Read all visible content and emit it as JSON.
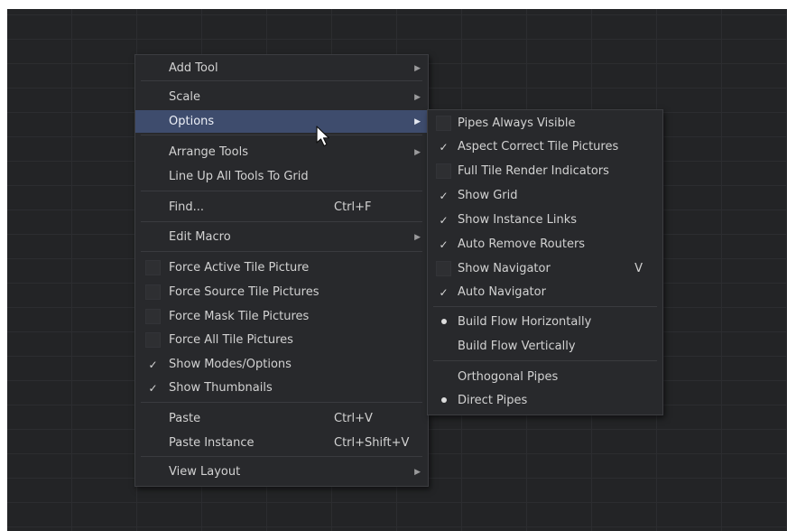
{
  "main_menu": {
    "add_tool": "Add Tool",
    "scale": "Scale",
    "options": "Options",
    "arrange_tools": "Arrange Tools",
    "line_up": "Line Up All Tools To Grid",
    "find": "Find...",
    "find_shortcut": "Ctrl+F",
    "edit_macro": "Edit Macro",
    "force_active": "Force Active Tile Picture",
    "force_source": "Force Source Tile Pictures",
    "force_mask": "Force Mask Tile Pictures",
    "force_all": "Force All Tile Pictures",
    "show_modes": "Show Modes/Options",
    "show_thumbnails": "Show Thumbnails",
    "paste": "Paste",
    "paste_shortcut": "Ctrl+V",
    "paste_instance": "Paste Instance",
    "paste_instance_shortcut": "Ctrl+Shift+V",
    "view_layout": "View Layout"
  },
  "options_menu": {
    "pipes_always_visible": "Pipes Always Visible",
    "aspect_correct": "Aspect Correct Tile Pictures",
    "full_tile_render": "Full Tile Render Indicators",
    "show_grid": "Show Grid",
    "show_instance_links": "Show Instance Links",
    "auto_remove_routers": "Auto Remove Routers",
    "show_navigator": "Show Navigator",
    "show_navigator_shortcut": "V",
    "auto_navigator": "Auto Navigator",
    "build_horizontal": "Build Flow Horizontally",
    "build_vertical": "Build Flow Vertically",
    "orthogonal_pipes": "Orthogonal Pipes",
    "direct_pipes": "Direct Pipes"
  },
  "glyphs": {
    "check": "✓",
    "arrow": "▶"
  },
  "colors": {
    "highlight": "#3e4c6d",
    "menu_bg": "#28292c",
    "canvas_bg": "#232426"
  }
}
